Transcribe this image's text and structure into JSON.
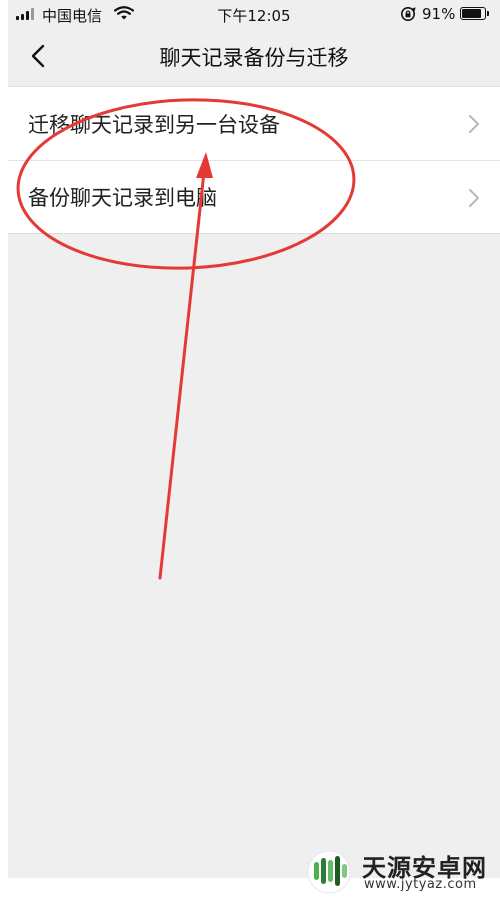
{
  "status_bar": {
    "carrier": "中国电信",
    "time": "下午12:05",
    "battery_percent": "91%",
    "battery_level": 0.91
  },
  "nav": {
    "title": "聊天记录备份与迁移",
    "back_icon": "chevron-left-icon"
  },
  "list": {
    "items": [
      {
        "label": "迁移聊天记录到另一台设备",
        "icon": "chevron-right-icon"
      },
      {
        "label": "备份聊天记录到电脑",
        "icon": "chevron-right-icon"
      }
    ]
  },
  "annotation": {
    "color": "#e53935"
  },
  "watermark": {
    "title": "天源安卓网",
    "url": "www.jytyaz.com"
  },
  "colors": {
    "background": "#efefef",
    "list_bg": "#ffffff",
    "text": "#222222",
    "chevron": "#b8b8b8"
  }
}
